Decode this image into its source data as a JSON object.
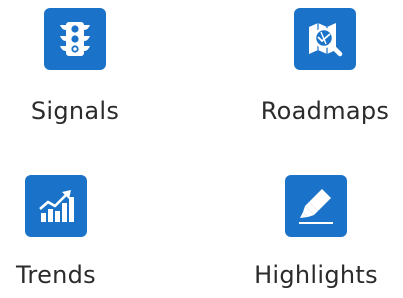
{
  "accent_color": "#1a73c8",
  "tiles": [
    {
      "label": "Signals",
      "icon": "traffic-light-icon"
    },
    {
      "label": "Roadmaps",
      "icon": "map-search-icon"
    },
    {
      "label": "Trends",
      "icon": "trend-chart-icon"
    },
    {
      "label": "Highlights",
      "icon": "highlighter-icon"
    }
  ]
}
